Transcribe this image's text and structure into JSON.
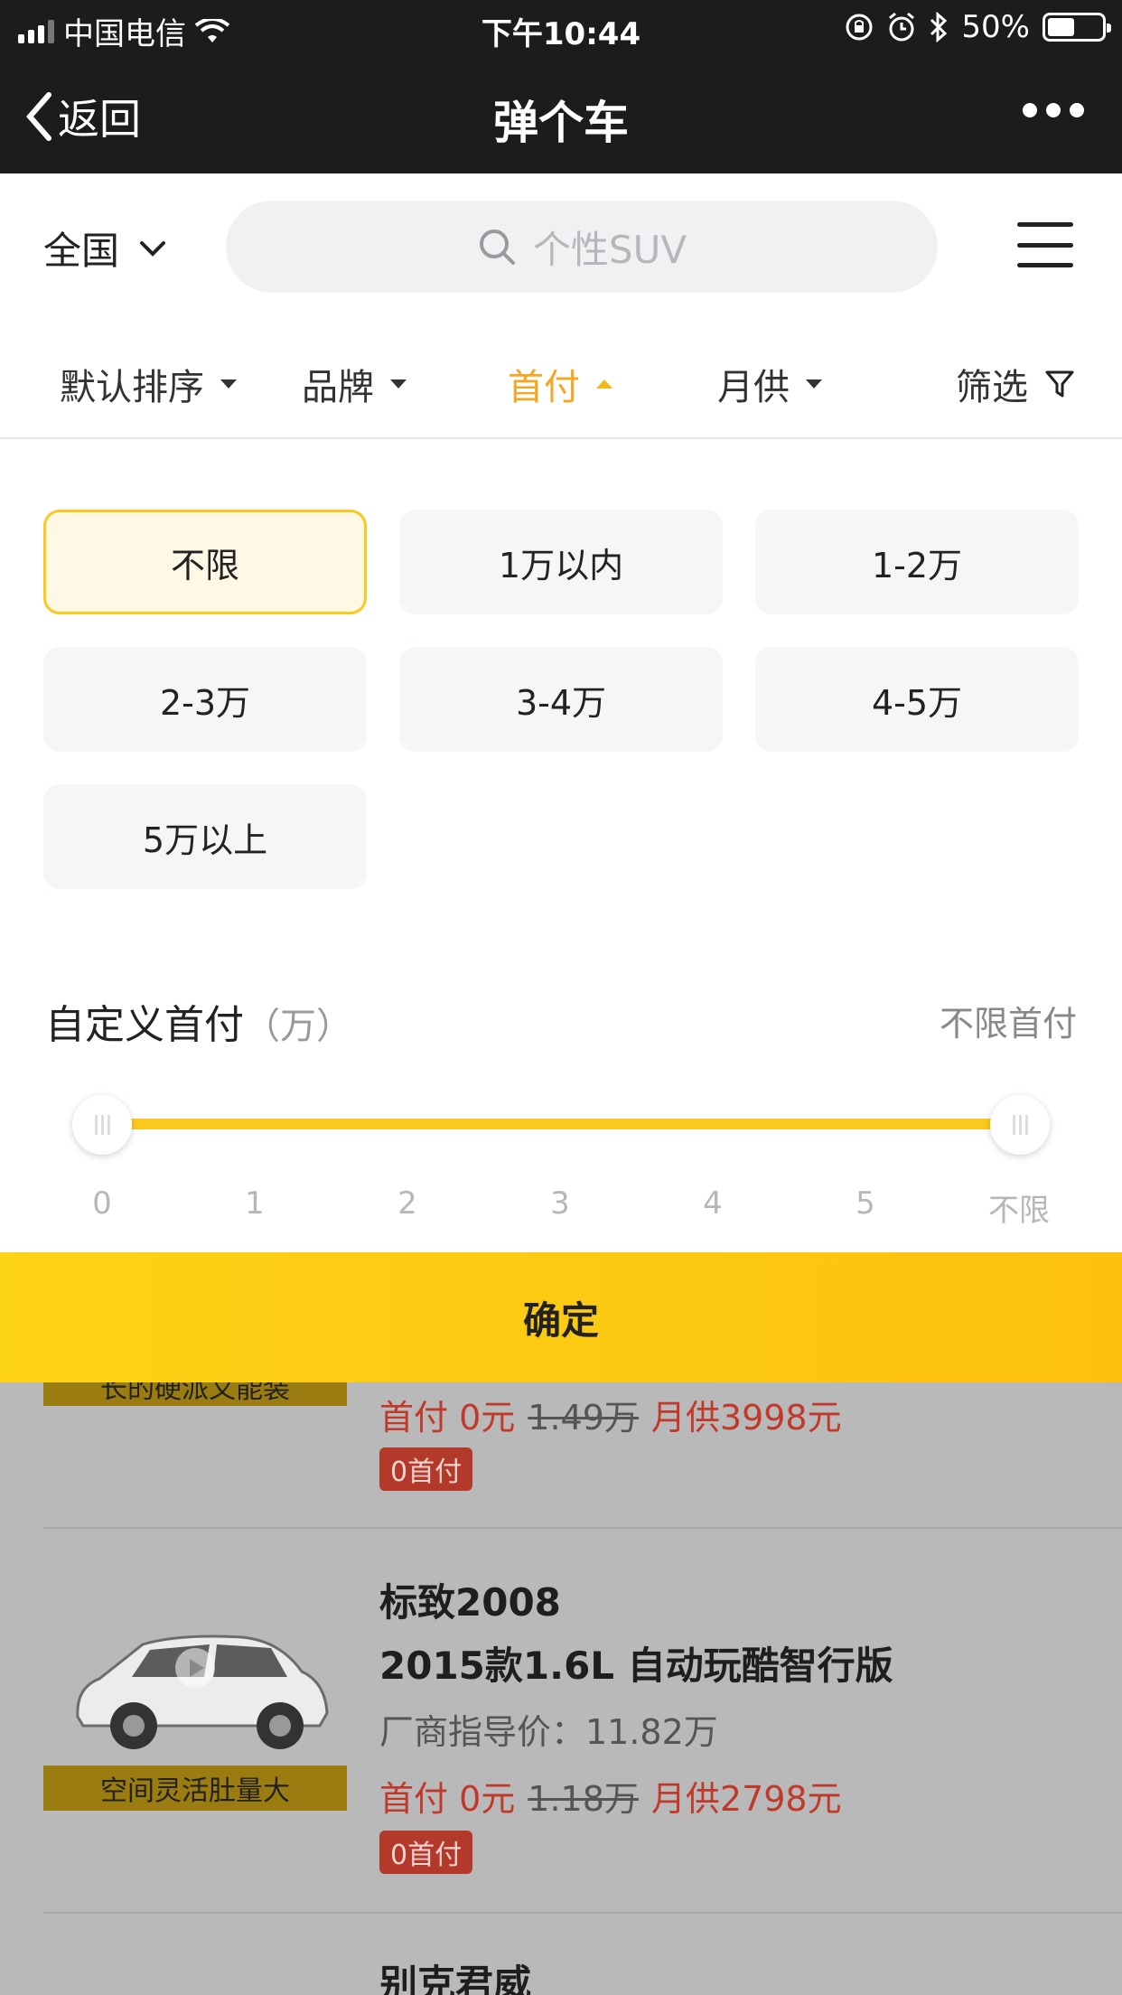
{
  "status_bar": {
    "carrier": "中国电信",
    "time": "下午10:44",
    "battery": "50%",
    "battery_level": 0.5
  },
  "nav": {
    "back_label": "返回",
    "title": "弹个车"
  },
  "search": {
    "region": "全国",
    "placeholder": "个性SUV"
  },
  "sort_tabs": [
    {
      "label": "默认排序"
    },
    {
      "label": "品牌"
    },
    {
      "label": "首付"
    },
    {
      "label": "月供"
    },
    {
      "label": "筛选"
    }
  ],
  "down_payment_options": [
    {
      "label": "不限",
      "selected": true
    },
    {
      "label": "1万以内"
    },
    {
      "label": "1-2万"
    },
    {
      "label": "2-3万"
    },
    {
      "label": "3-4万"
    },
    {
      "label": "4-5万"
    },
    {
      "label": "5万以上"
    }
  ],
  "custom": {
    "label": "自定义首付",
    "unit": "（万）",
    "unlimited_label": "不限首付",
    "ticks": [
      "0",
      "1",
      "2",
      "3",
      "4",
      "5",
      "不限"
    ],
    "range_min": "0",
    "range_max": "不限"
  },
  "confirm_label": "确定",
  "listings": [
    {
      "thumb_tag": "长的硬派又能装",
      "down_payment": "首付 0元",
      "old_price": "1.49万",
      "monthly": "月供3998元",
      "badge": "0首付"
    },
    {
      "name": "标致2008",
      "model": "2015款1.6L 自动玩酷智行版",
      "guide_price": "厂商指导价：11.82万",
      "thumb_tag": "空间灵活肚量大",
      "down_payment": "首付 0元",
      "old_price": "1.18万",
      "monthly": "月供2798元",
      "badge": "0首付"
    },
    {
      "name": "别克君威"
    }
  ]
}
